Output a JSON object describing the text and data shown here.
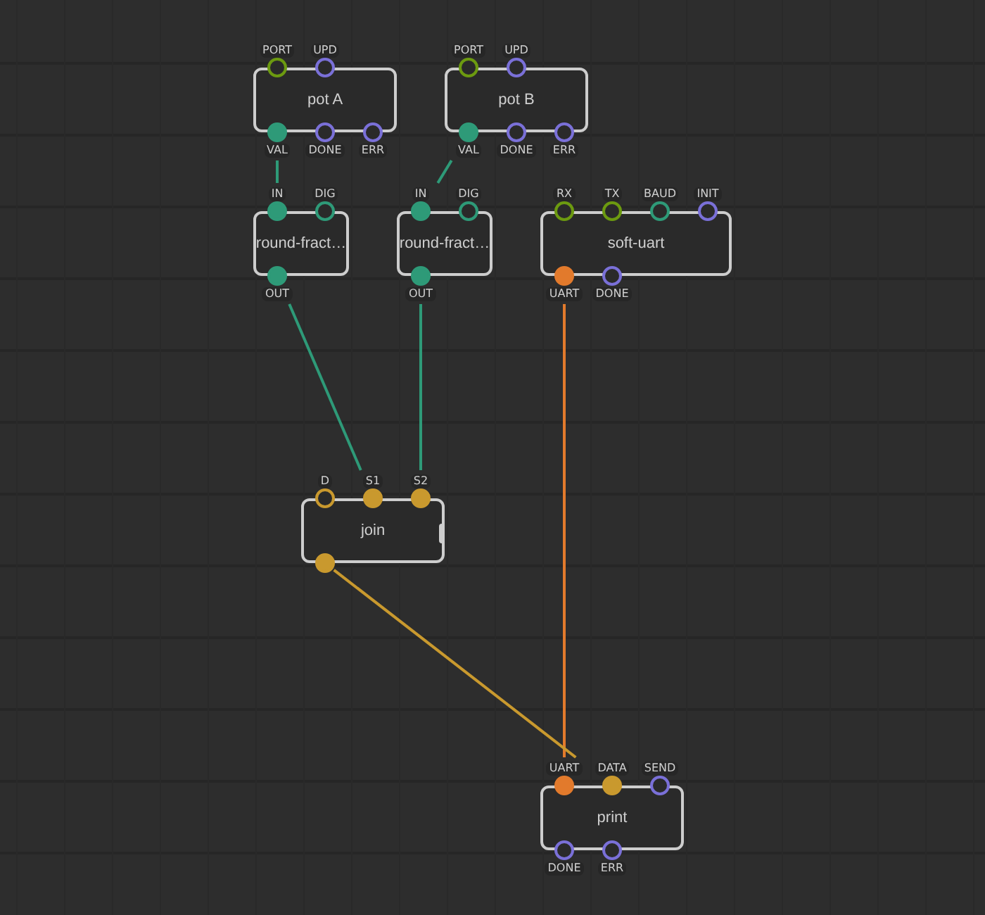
{
  "nodes": [
    {
      "label": "pot A",
      "pins_top": [
        {
          "label": "PORT",
          "color": "#6c9a10",
          "connected": false
        },
        {
          "label": "UPD",
          "color": "#7a70d8",
          "connected": false
        }
      ],
      "pins_bottom": [
        {
          "label": "VAL",
          "color": "#2e9a78",
          "connected": true
        },
        {
          "label": "DONE",
          "color": "#7a70d8",
          "connected": false
        },
        {
          "label": "ERR",
          "color": "#7a70d8",
          "connected": false
        }
      ]
    },
    {
      "label": "pot B",
      "pins_top": [
        {
          "label": "PORT",
          "color": "#6c9a10",
          "connected": false
        },
        {
          "label": "UPD",
          "color": "#7a70d8",
          "connected": false
        }
      ],
      "pins_bottom": [
        {
          "label": "VAL",
          "color": "#2e9a78",
          "connected": true
        },
        {
          "label": "DONE",
          "color": "#7a70d8",
          "connected": false
        },
        {
          "label": "ERR",
          "color": "#7a70d8",
          "connected": false
        }
      ]
    },
    {
      "label": "round-fract…",
      "pins_top": [
        {
          "label": "IN",
          "color": "#2e9a78",
          "connected": true
        },
        {
          "label": "DIG",
          "color": "#2e9a78",
          "connected": false
        }
      ],
      "pins_bottom": [
        {
          "label": "OUT",
          "color": "#2e9a78",
          "connected": true
        }
      ]
    },
    {
      "label": "round-fract…",
      "pins_top": [
        {
          "label": "IN",
          "color": "#2e9a78",
          "connected": true
        },
        {
          "label": "DIG",
          "color": "#2e9a78",
          "connected": false
        }
      ],
      "pins_bottom": [
        {
          "label": "OUT",
          "color": "#2e9a78",
          "connected": true
        }
      ]
    },
    {
      "label": "soft-uart",
      "pins_top": [
        {
          "label": "RX",
          "color": "#6c9a10",
          "connected": false
        },
        {
          "label": "TX",
          "color": "#6c9a10",
          "connected": false
        },
        {
          "label": "BAUD",
          "color": "#2e9a78",
          "connected": false
        },
        {
          "label": "INIT",
          "color": "#7a70d8",
          "connected": false
        }
      ],
      "pins_bottom": [
        {
          "label": "UART",
          "color": "#e27a2c",
          "connected": true
        },
        {
          "label": "DONE",
          "color": "#7a70d8",
          "connected": false
        }
      ]
    },
    {
      "label": "join",
      "variadic": true,
      "pins_top": [
        {
          "label": "D",
          "color": "#c9992e",
          "connected": false
        },
        {
          "label": "S1",
          "color": "#c9992e",
          "connected": true
        },
        {
          "label": "S2",
          "color": "#c9992e",
          "connected": true
        }
      ],
      "pins_bottom": [
        {
          "color": "#c9992e",
          "connected": true
        }
      ]
    },
    {
      "label": "print",
      "pins_top": [
        {
          "label": "UART",
          "color": "#e27a2c",
          "connected": true
        },
        {
          "label": "DATA",
          "color": "#c9992e",
          "connected": true
        },
        {
          "label": "SEND",
          "color": "#7a70d8",
          "connected": false
        }
      ],
      "pins_bottom": [
        {
          "label": "DONE",
          "color": "#7a70d8",
          "connected": false
        },
        {
          "label": "ERR",
          "color": "#7a70d8",
          "connected": false
        }
      ]
    }
  ]
}
